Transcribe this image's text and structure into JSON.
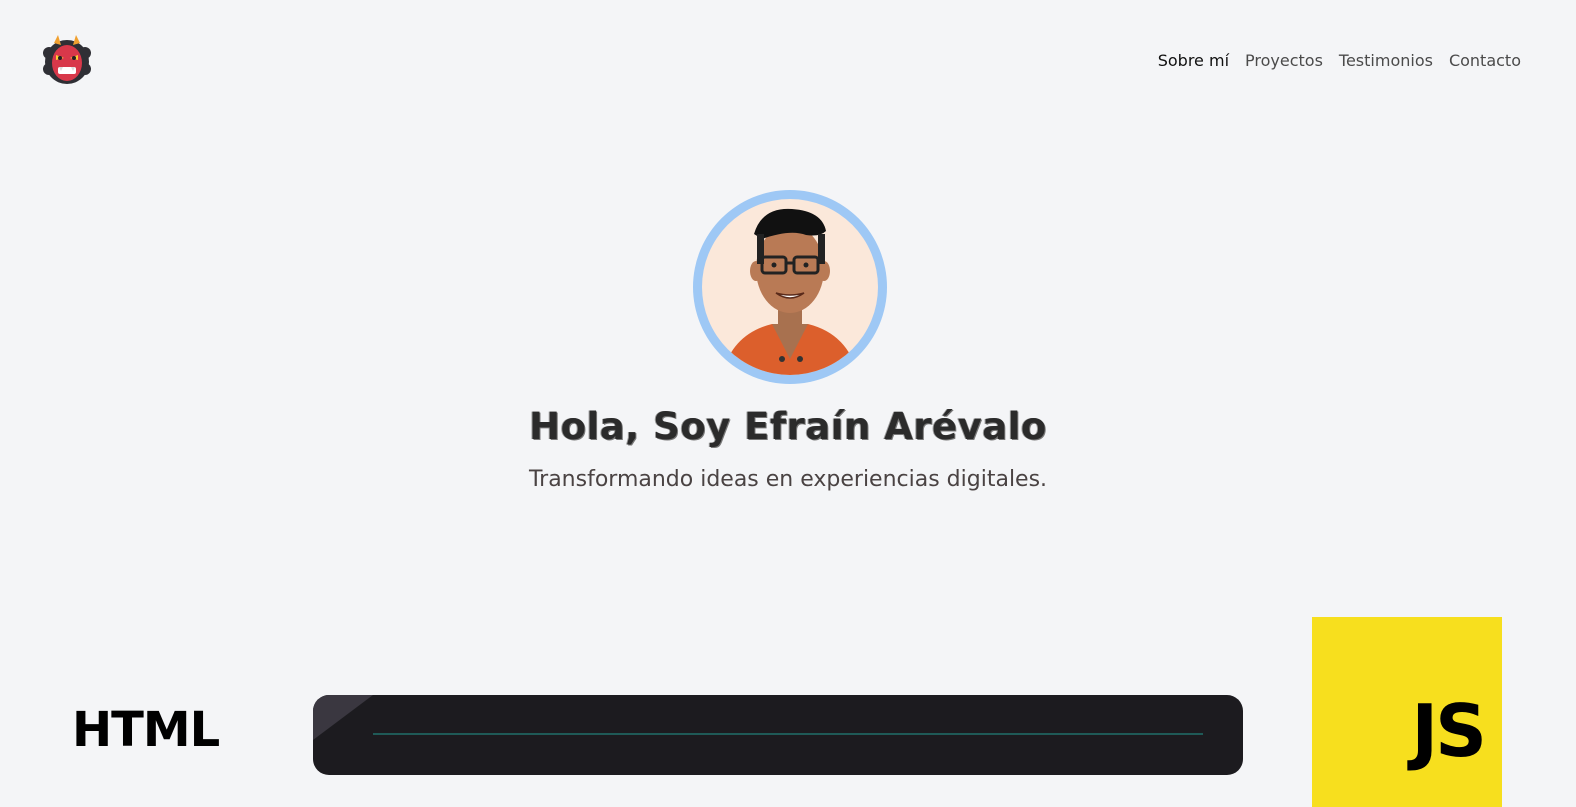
{
  "header": {
    "logo": "oni-mask-icon",
    "nav": [
      {
        "label": "Sobre mí",
        "active": true
      },
      {
        "label": "Proyectos",
        "active": false
      },
      {
        "label": "Testimonios",
        "active": false
      },
      {
        "label": "Contacto",
        "active": false
      }
    ]
  },
  "hero": {
    "avatar": "avatar-illustration",
    "title": "Hola, Soy Efraín Arévalo",
    "subtitle": "Transformando ideas en experiencias digitales."
  },
  "skills": {
    "html_label": "HTML",
    "js_label": "JS"
  },
  "colors": {
    "background": "#f4f5f7",
    "avatar_ring": "#9ec8f5",
    "js_yellow": "#f7df1e",
    "editor_bg": "#1c1b1f"
  }
}
